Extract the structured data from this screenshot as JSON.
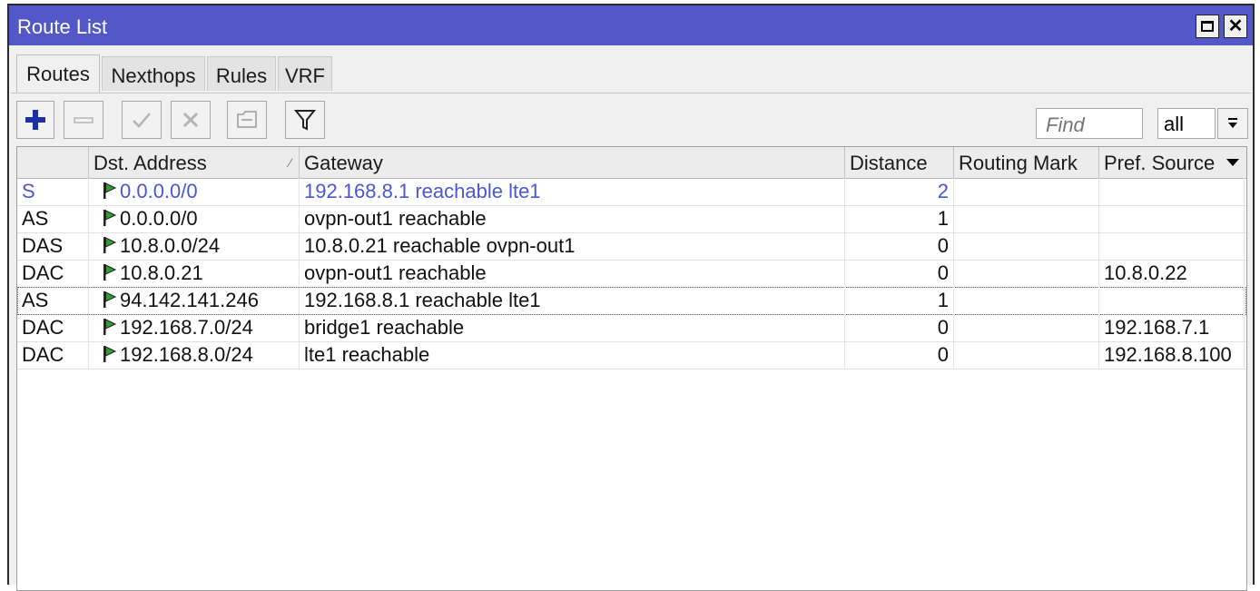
{
  "window": {
    "title": "Route List"
  },
  "tabs": [
    {
      "label": "Routes",
      "active": true
    },
    {
      "label": "Nexthops",
      "active": false
    },
    {
      "label": "Rules",
      "active": false
    },
    {
      "label": "VRF",
      "active": false
    }
  ],
  "toolbar": {
    "buttons": [
      "add-icon",
      "remove-icon",
      "enable-icon",
      "disable-icon",
      "comment-icon",
      "filter-icon"
    ],
    "find_placeholder": "Find",
    "filter_value": "all"
  },
  "table": {
    "columns": [
      "",
      "Dst. Address",
      "Gateway",
      "Distance",
      "Routing Mark",
      "Pref. Source"
    ],
    "rows": [
      {
        "flags": "S",
        "dst": "0.0.0.0/0",
        "gateway": "192.168.8.1 reachable lte1",
        "distance": "2",
        "mark": "",
        "pref": ""
      },
      {
        "flags": "AS",
        "dst": "0.0.0.0/0",
        "gateway": "ovpn-out1 reachable",
        "distance": "1",
        "mark": "",
        "pref": ""
      },
      {
        "flags": "DAS",
        "dst": "10.8.0.0/24",
        "gateway": "10.8.0.21 reachable ovpn-out1",
        "distance": "0",
        "mark": "",
        "pref": ""
      },
      {
        "flags": "DAC",
        "dst": "10.8.0.21",
        "gateway": "ovpn-out1 reachable",
        "distance": "0",
        "mark": "",
        "pref": "10.8.0.22"
      },
      {
        "flags": "AS",
        "dst": "94.142.141.246",
        "gateway": "192.168.8.1 reachable lte1",
        "distance": "1",
        "mark": "",
        "pref": ""
      },
      {
        "flags": "DAC",
        "dst": "192.168.7.0/24",
        "gateway": "bridge1 reachable",
        "distance": "0",
        "mark": "",
        "pref": "192.168.7.1"
      },
      {
        "flags": "DAC",
        "dst": "192.168.8.0/24",
        "gateway": "lte1 reachable",
        "distance": "0",
        "mark": "",
        "pref": "192.168.8.100"
      }
    ]
  },
  "colors": {
    "titlebar": "#5258c7",
    "static_route_text": "#4a56d4",
    "add_icon": "#1b2fa8",
    "flag": "#2fa12f"
  }
}
